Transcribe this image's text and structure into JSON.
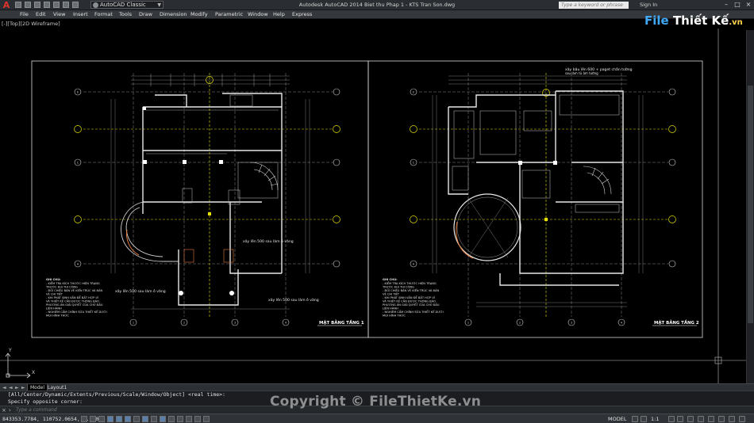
{
  "titlebar": {
    "workspace": "AutoCAD Classic",
    "window_title": "Autodesk AutoCAD 2014    Biet thu Phap 1 - KTS Tran Son.dwg",
    "search_placeholder": "Type a keyword or phrase",
    "signin": "Sign In"
  },
  "menu": [
    "File",
    "Edit",
    "View",
    "Insert",
    "Format",
    "Tools",
    "Draw",
    "Dimension",
    "Modify",
    "Parametric",
    "Window",
    "Help",
    "Express"
  ],
  "viewport_label": "[-][Top][2D Wireframe]",
  "logo": {
    "part1": "File",
    "part2": "Thiết Kế",
    "part3": ".vn"
  },
  "drawing": {
    "sheet1_title": "MẶT BẰNG TẦNG 1",
    "sheet2_title": "MẶT BẰNG TẦNG 2",
    "note1": "xây lên 500 sau làm ô văng",
    "note2": "xây lên 500 sau làm ô văng",
    "note3": "xây lên 500 sau làm ô văng",
    "note4": "xây bậu lên 600 + paget chắn tường",
    "note5": "sau làm tủ âm tường",
    "notes_heading": "GHI CHÚ:",
    "notes_lines": [
      "- KIỂM TRA KÍCH THƯỚC HIỆN TRẠNG",
      "  TRƯỚC KHI THI CÔNG",
      "- ĐỐI CHIẾU BẢN VẼ KIẾN TRÚC VÀ BẢN",
      "  VẼ CHI TIẾT",
      "- KHI PHÁT SINH VẤN ĐỀ BẤT HỢP LÝ",
      "  VÀ THIẾT KẾ CẦN ĐƯỢC THÔNG BÁO",
      "  PHƯƠNG ÁN GIẢI QUYẾT CỦA CHỦ ĐẦU",
      "  LIÊN HÀNH",
      "- NGHIÊM CẤM CHỈNH SỬA THIẾT KẾ DƯỚI",
      "  MỌI HÌNH THỨC"
    ],
    "grid_rows": [
      "E",
      "D",
      "C",
      "B",
      "A"
    ],
    "grid_cols": [
      "1",
      "2",
      "3",
      "4"
    ],
    "ucs_y": "Y",
    "ucs_x": "X"
  },
  "tabs": {
    "model": "Model",
    "layout1": "Layout1"
  },
  "command": {
    "history_line1": "[All/Center/Dynamic/Extents/Previous/Scale/Window/Object] <real time>:",
    "history_line2": "Specify opposite corner:",
    "input_placeholder": "Type a command"
  },
  "status": {
    "coords": "843353.7784, 110752.0654, 0.0000",
    "model": "MODEL",
    "scale": "1:1"
  },
  "copyright": "Copyright © FileThietKe.vn"
}
